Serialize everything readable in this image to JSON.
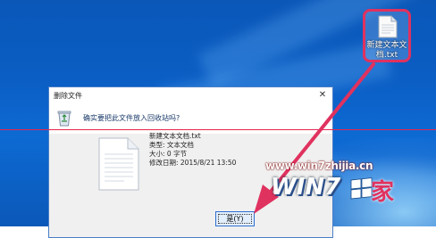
{
  "desktop": {
    "icon": {
      "name": "file-icon",
      "label": "新建文本文档.txt"
    }
  },
  "dialog": {
    "title": "删除文件",
    "close_symbol": "✕",
    "message": "确实要把此文件放入回收站吗?",
    "file_name": "新建文本文档.txt",
    "type_line": "类型: 文本文档",
    "size_line": "大小: 0 字节",
    "modified_line": "修改日期: 2015/8/21 13:50",
    "yes_button": "是(Y)"
  },
  "watermark": {
    "url": "www.win7zhijia.cn",
    "logo_text": "WIN7",
    "logo_char": "家"
  },
  "colors": {
    "desktop_blue": "#0b5ec4",
    "highlight_red": "#e0325f",
    "button_border": "#2f6fd1"
  }
}
